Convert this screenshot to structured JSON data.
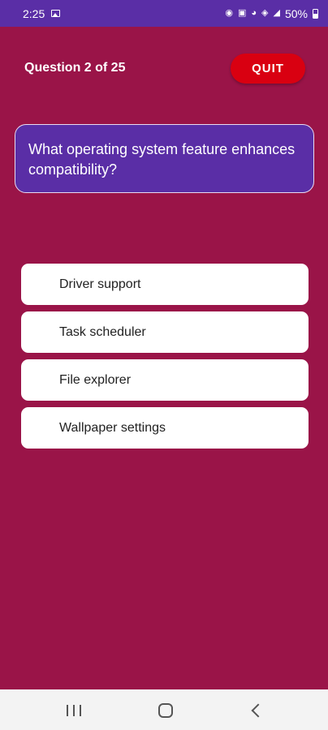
{
  "status_bar": {
    "time": "2:25",
    "battery_text": "50%",
    "icons": [
      "image-icon",
      "bug-icon",
      "nfc-icon",
      "cast-icon",
      "wifi-icon",
      "signal-icon",
      "battery-icon"
    ]
  },
  "header": {
    "question_counter": "Question 2 of 25",
    "quit_label": "QUIT"
  },
  "question": {
    "text": "What operating system feature enhances compatibility?"
  },
  "options": [
    {
      "label": "Driver support"
    },
    {
      "label": "Task scheduler"
    },
    {
      "label": "File explorer"
    },
    {
      "label": "Wallpaper settings"
    }
  ],
  "colors": {
    "background": "#9a1448",
    "status_bar": "#5a2ea6",
    "question_card": "#5a2ea6",
    "quit_button": "#d90011",
    "option_background": "#ffffff"
  }
}
